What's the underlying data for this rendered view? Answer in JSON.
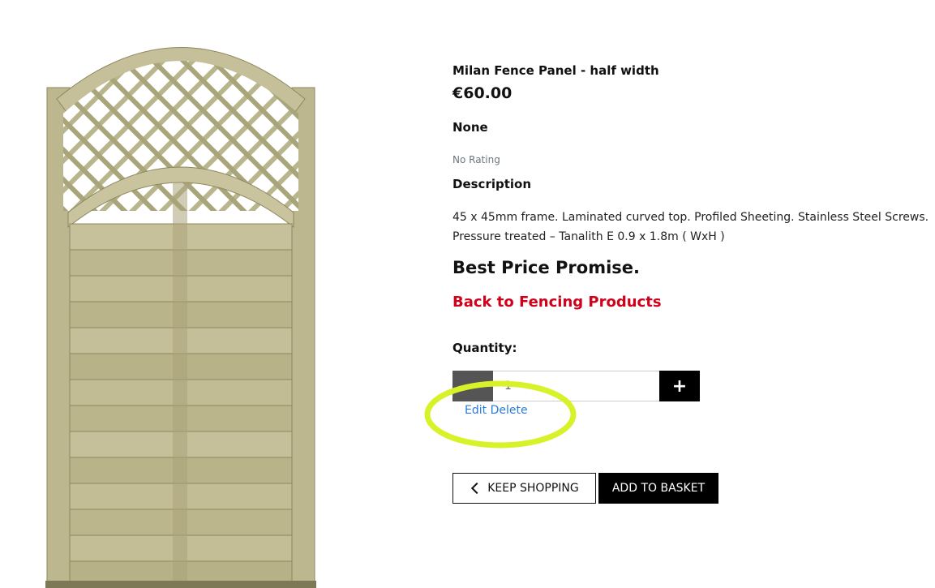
{
  "product": {
    "name": "Milan Fence Panel - half width",
    "price": "€60.00",
    "category": "None",
    "rating": "No Rating",
    "description_heading": "Description",
    "description": "45 x 45mm frame. Laminated curved top. Profiled Sheeting. Stainless Steel Screws. Pressure treated – Tanalith E 0.9 x 1.8m ( WxH )",
    "promise": "Best Price Promise.",
    "back_link": "Back to Fencing Products"
  },
  "quantity": {
    "label": "Quantity:",
    "value": "1",
    "plus_label": "+"
  },
  "admin": {
    "edit": "Edit",
    "delete": "Delete"
  },
  "buttons": {
    "keep_shopping": "KEEP SHOPPING",
    "add_to_basket": "ADD TO BASKET"
  },
  "colors": {
    "back_link": "#d0021b",
    "admin_link": "#2b7bd8",
    "highlight": "#d8f22a"
  },
  "icons": {
    "keep_shopping": "chevron-left-icon"
  }
}
